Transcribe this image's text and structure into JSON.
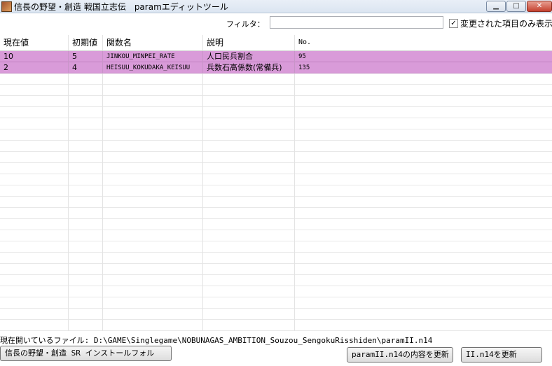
{
  "window": {
    "title": "信長の野望・創造 戦国立志伝　paramエディットツール",
    "minimize_glyph": "▁",
    "maximize_glyph": "□",
    "close_glyph": "✕"
  },
  "toolbar": {
    "filter_label": "フィルタ：",
    "filter_value": "",
    "changed_only_checked": true,
    "changed_only_label": "変更された項目のみ表示"
  },
  "table": {
    "columns": [
      "現在値",
      "初期値",
      "関数名",
      "説明",
      "No."
    ],
    "rows": [
      {
        "current": "10",
        "initial": "5",
        "function": "JINKOU_MINPEI_RATE",
        "description": "人口民兵割合",
        "no": "95"
      },
      {
        "current": "2",
        "initial": "4",
        "function": "HEISUU_KOKUDAKA_KEISUU",
        "description": "兵数石高係数(常備兵)",
        "no": "135"
      }
    ]
  },
  "status": {
    "open_file": "現在開いているファイル: D:\\GAME\\Singlegame\\NOBUNAGAS_AMBITION_Souzou_SengokuRisshiden\\paramII.n14"
  },
  "buttons": {
    "install_folder": "信長の野望・創造 SR  インストールフォル",
    "update_contents": "paramII.n14の内容を更新",
    "update_file": "II.n14を更新"
  }
}
